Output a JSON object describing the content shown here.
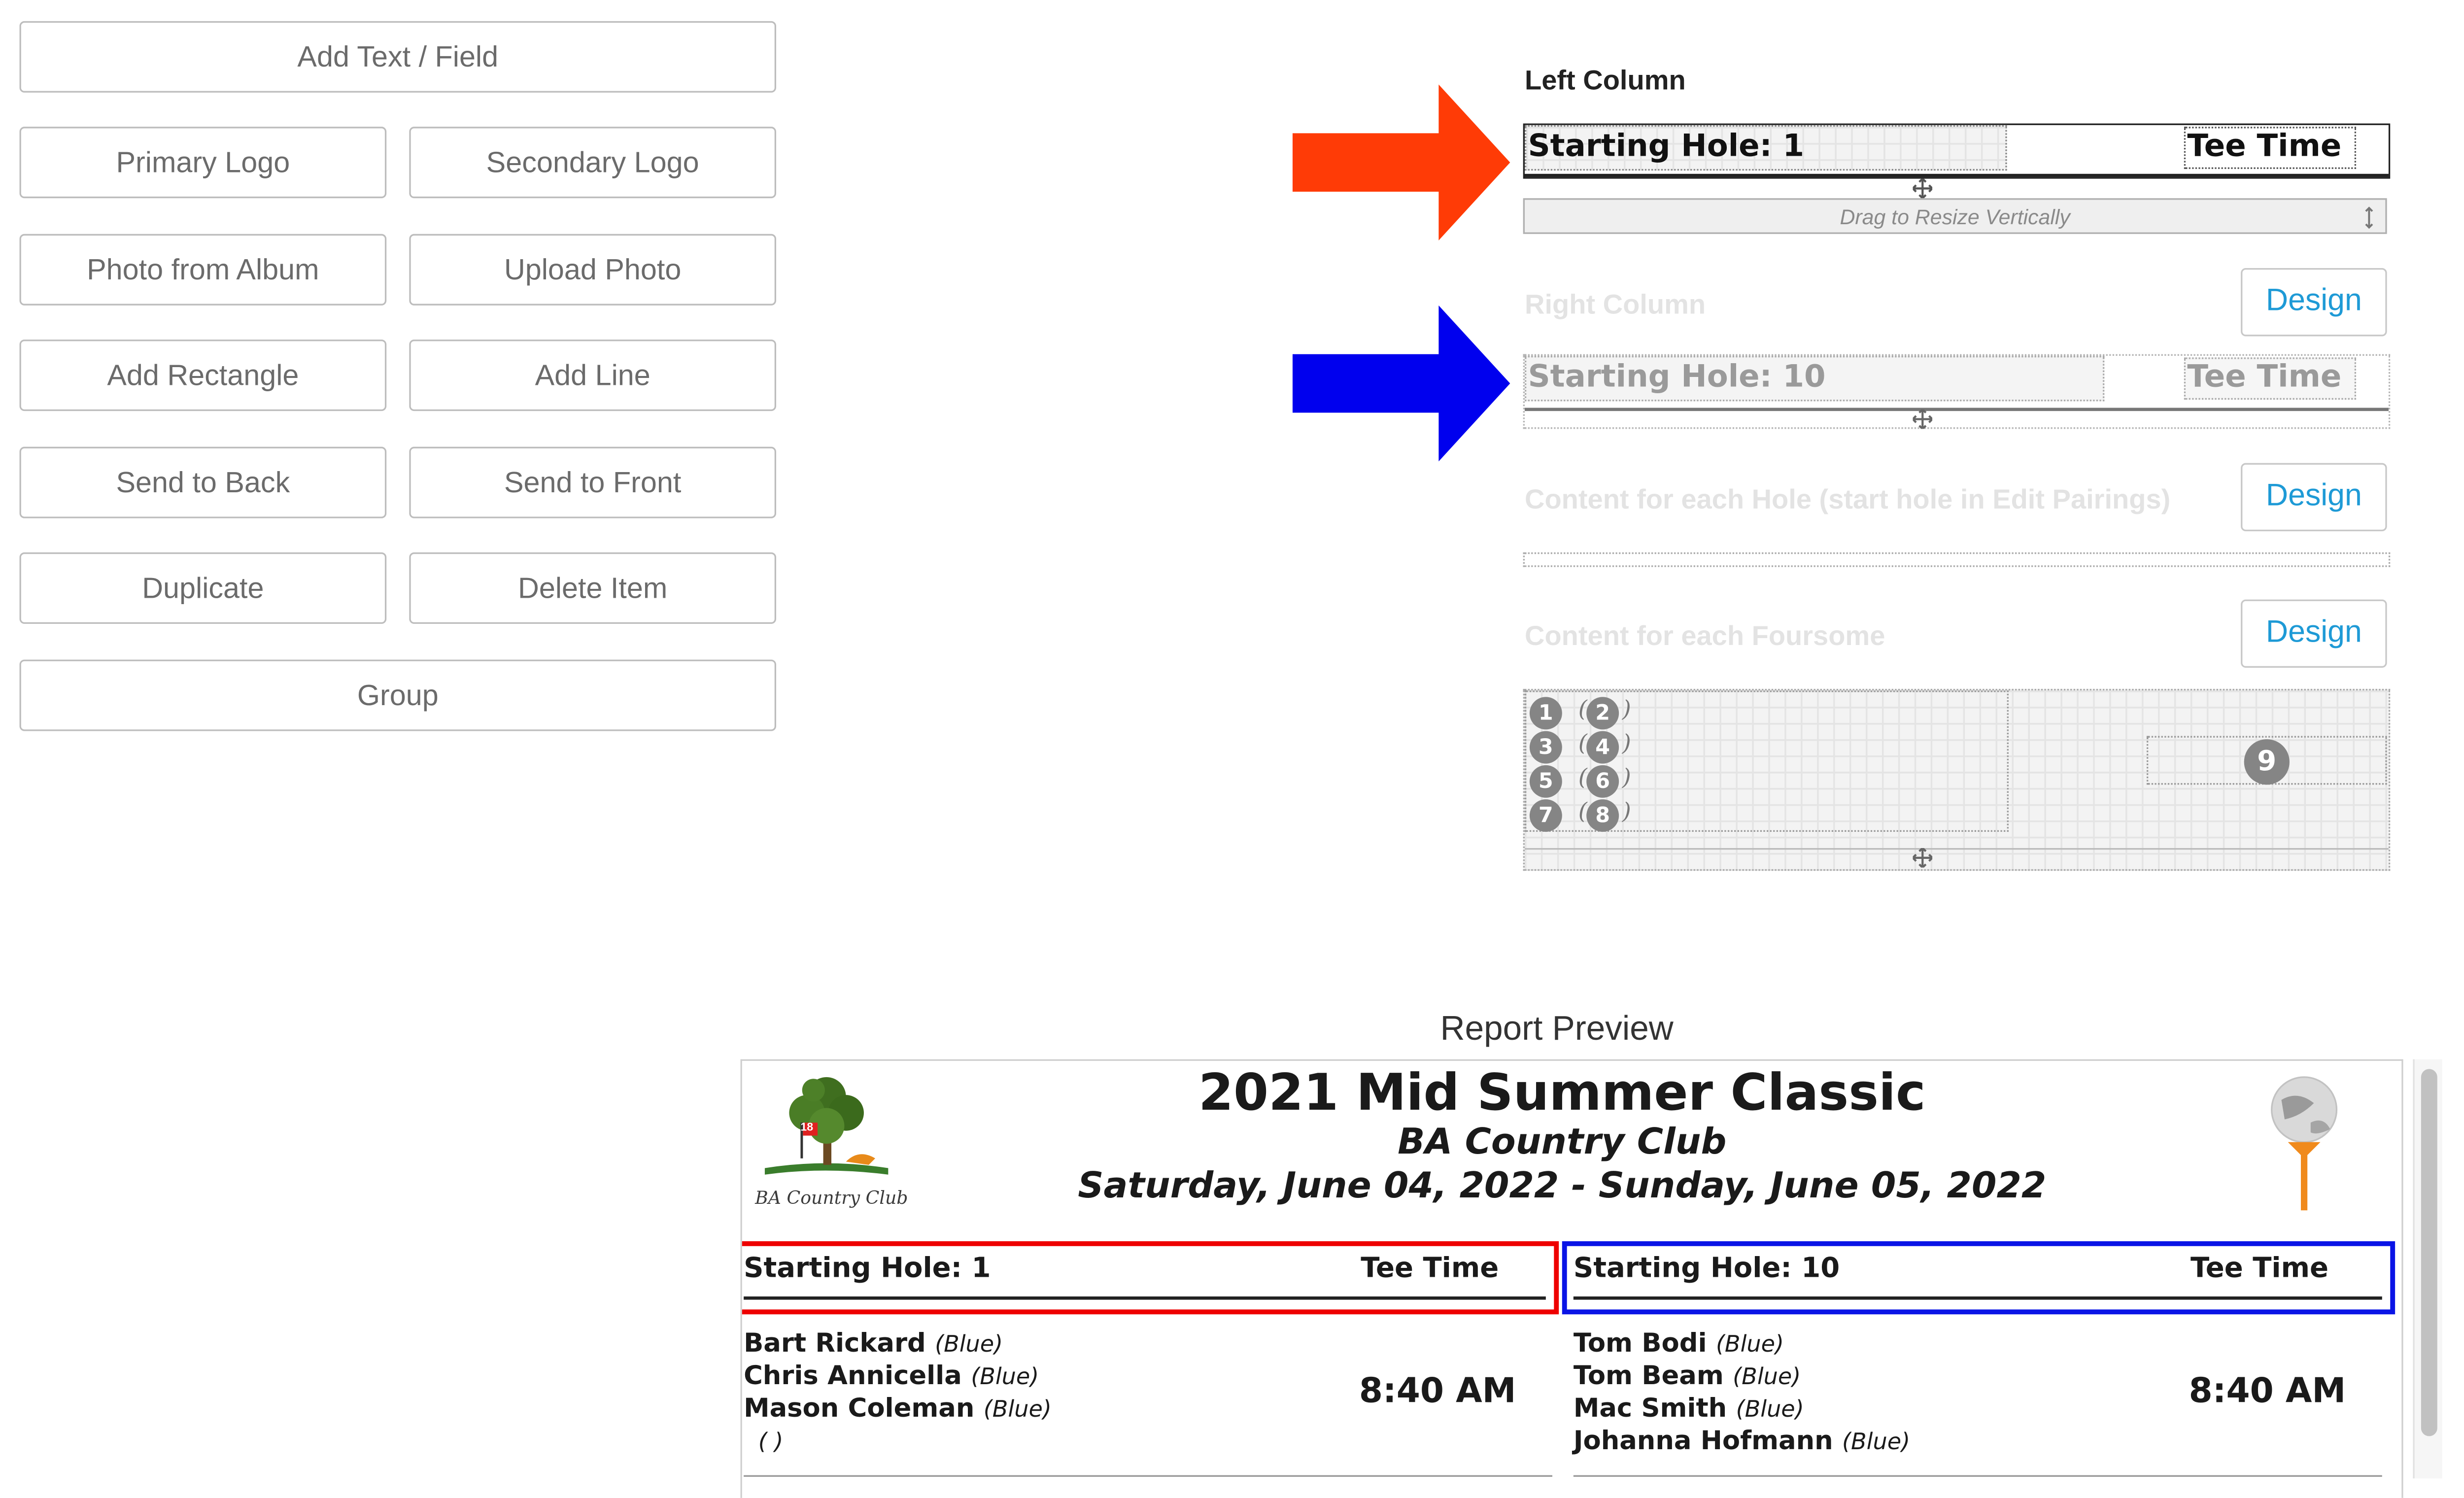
{
  "toolbar": {
    "add_text_field": "Add Text / Field",
    "primary_logo": "Primary Logo",
    "secondary_logo": "Secondary Logo",
    "photo_from_album": "Photo from Album",
    "upload_photo": "Upload Photo",
    "add_rectangle": "Add Rectangle",
    "add_line": "Add Line",
    "send_to_back": "Send to Back",
    "send_to_front": "Send to Front",
    "duplicate": "Duplicate",
    "delete_item": "Delete Item",
    "group": "Group"
  },
  "designer": {
    "left_column": {
      "label": "Left Column",
      "starting_hole": "Starting Hole: 1",
      "tee_time": "Tee Time",
      "resize_hint": "Drag to Resize Vertically"
    },
    "right_column": {
      "label": "Right Column",
      "design_label": "Design",
      "starting_hole": "Starting Hole: 10",
      "tee_time": "Tee Time"
    },
    "hole_content": {
      "label": "Content for each Hole (start hole in Edit Pairings)",
      "design_label": "Design"
    },
    "foursome_content": {
      "label": "Content for each Foursome",
      "design_label": "Design",
      "player_numbers": [
        "1",
        "3",
        "5",
        "7"
      ],
      "tee_numbers": [
        "2",
        "4",
        "6",
        "8"
      ],
      "time_number": "9"
    }
  },
  "preview": {
    "title": "Report Preview",
    "event_title": "2021 Mid Summer Classic",
    "club_name": "BA Country Club",
    "dates": "Saturday, June 04, 2022 - Sunday, June 05, 2022",
    "logo_text": "BA Country Club",
    "logo_flag_number": "18",
    "left": {
      "starting_hole": "Starting Hole: 1",
      "tee_time_header": "Tee Time",
      "tee_time": "8:40 AM",
      "players": [
        {
          "name": "Bart Rickard",
          "tee": "(Blue)"
        },
        {
          "name": "Chris Annicella",
          "tee": "(Blue)"
        },
        {
          "name": "Mason Coleman",
          "tee": "(Blue)"
        },
        {
          "name": "",
          "tee": "( )"
        }
      ]
    },
    "right": {
      "starting_hole": "Starting Hole: 10",
      "tee_time_header": "Tee Time",
      "tee_time": "8:40 AM",
      "players": [
        {
          "name": "Tom Bodi",
          "tee": "(Blue)"
        },
        {
          "name": "Tom Beam",
          "tee": "(Blue)"
        },
        {
          "name": "Mac Smith",
          "tee": "(Blue)"
        },
        {
          "name": "Johanna Hofmann",
          "tee": "(Blue)"
        }
      ]
    }
  },
  "colors": {
    "red_arrow": "#ff3b06",
    "blue_arrow": "#0000ee",
    "red_highlight": "#ee0000",
    "blue_highlight": "#0a14e6",
    "design_link": "#1e9ad6",
    "tee_orange": "#f08a1c"
  }
}
